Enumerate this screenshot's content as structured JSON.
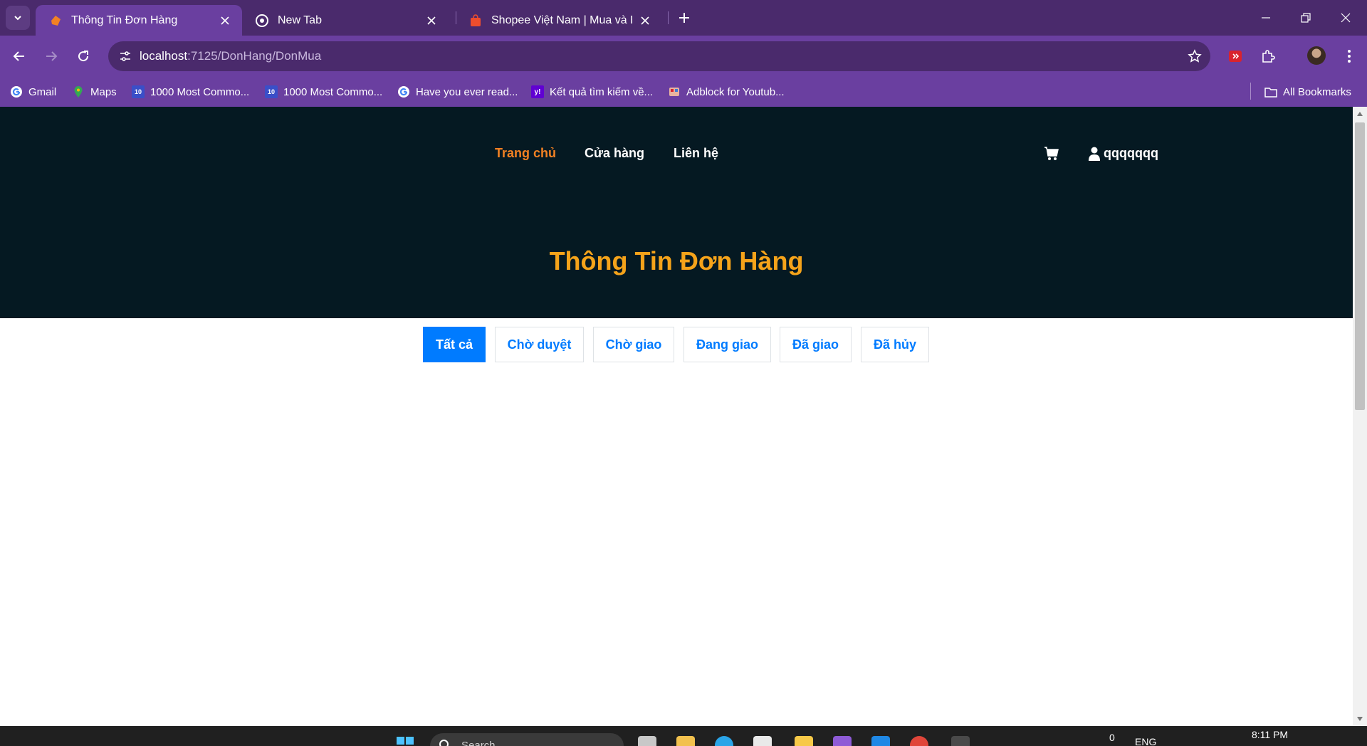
{
  "browser": {
    "tabs": [
      {
        "title": "Thông Tin Đơn Hàng",
        "active": true,
        "icon": "orange-logo-icon"
      },
      {
        "title": "New Tab",
        "active": false,
        "icon": "chrome-icon"
      },
      {
        "title": "Shopee Việt Nam | Mua và Bán",
        "active": false,
        "icon": "shopee-icon"
      }
    ],
    "url": {
      "host": "localhost",
      "path": ":7125/DonHang/DonMua"
    },
    "bookmarks": [
      {
        "label": "Gmail",
        "icon": "google-icon"
      },
      {
        "label": "Maps",
        "icon": "maps-icon"
      },
      {
        "label": "1000 Most Commo...",
        "icon": "1000-icon",
        "badge": "10\n00"
      },
      {
        "label": "1000 Most Commo...",
        "icon": "1000-icon",
        "badge": "10\n00"
      },
      {
        "label": "Have you ever read...",
        "icon": "google-icon"
      },
      {
        "label": "Kết quả tìm kiếm về...",
        "icon": "yahoo-icon",
        "badge": "y!"
      },
      {
        "label": "Adblock for Youtub...",
        "icon": "adblock-icon"
      }
    ],
    "all_bookmarks": "All Bookmarks",
    "colors": {
      "frame": "#4a2a6c",
      "toolbar": "#6a3fa0"
    }
  },
  "site": {
    "nav": [
      {
        "label": "Trang chủ",
        "active": true
      },
      {
        "label": "Cửa hàng",
        "active": false
      },
      {
        "label": "Liên hệ",
        "active": false
      }
    ],
    "username": "qqqqqqq",
    "page_title": "Thông Tin Đơn Hàng",
    "filters": [
      {
        "label": "Tất cả",
        "active": true
      },
      {
        "label": "Chờ duyệt",
        "active": false
      },
      {
        "label": "Chờ giao",
        "active": false
      },
      {
        "label": "Đang giao",
        "active": false
      },
      {
        "label": "Đã giao",
        "active": false
      },
      {
        "label": "Đã hủy",
        "active": false
      }
    ],
    "colors": {
      "hero_bg": "#051922",
      "nav_active": "#f28123",
      "title": "#f5a31a",
      "primary": "#007bff"
    }
  },
  "taskbar": {
    "search_placeholder": "Search",
    "tray": {
      "language": "ENG",
      "time": "8:11 PM",
      "notif_count": "0"
    }
  }
}
